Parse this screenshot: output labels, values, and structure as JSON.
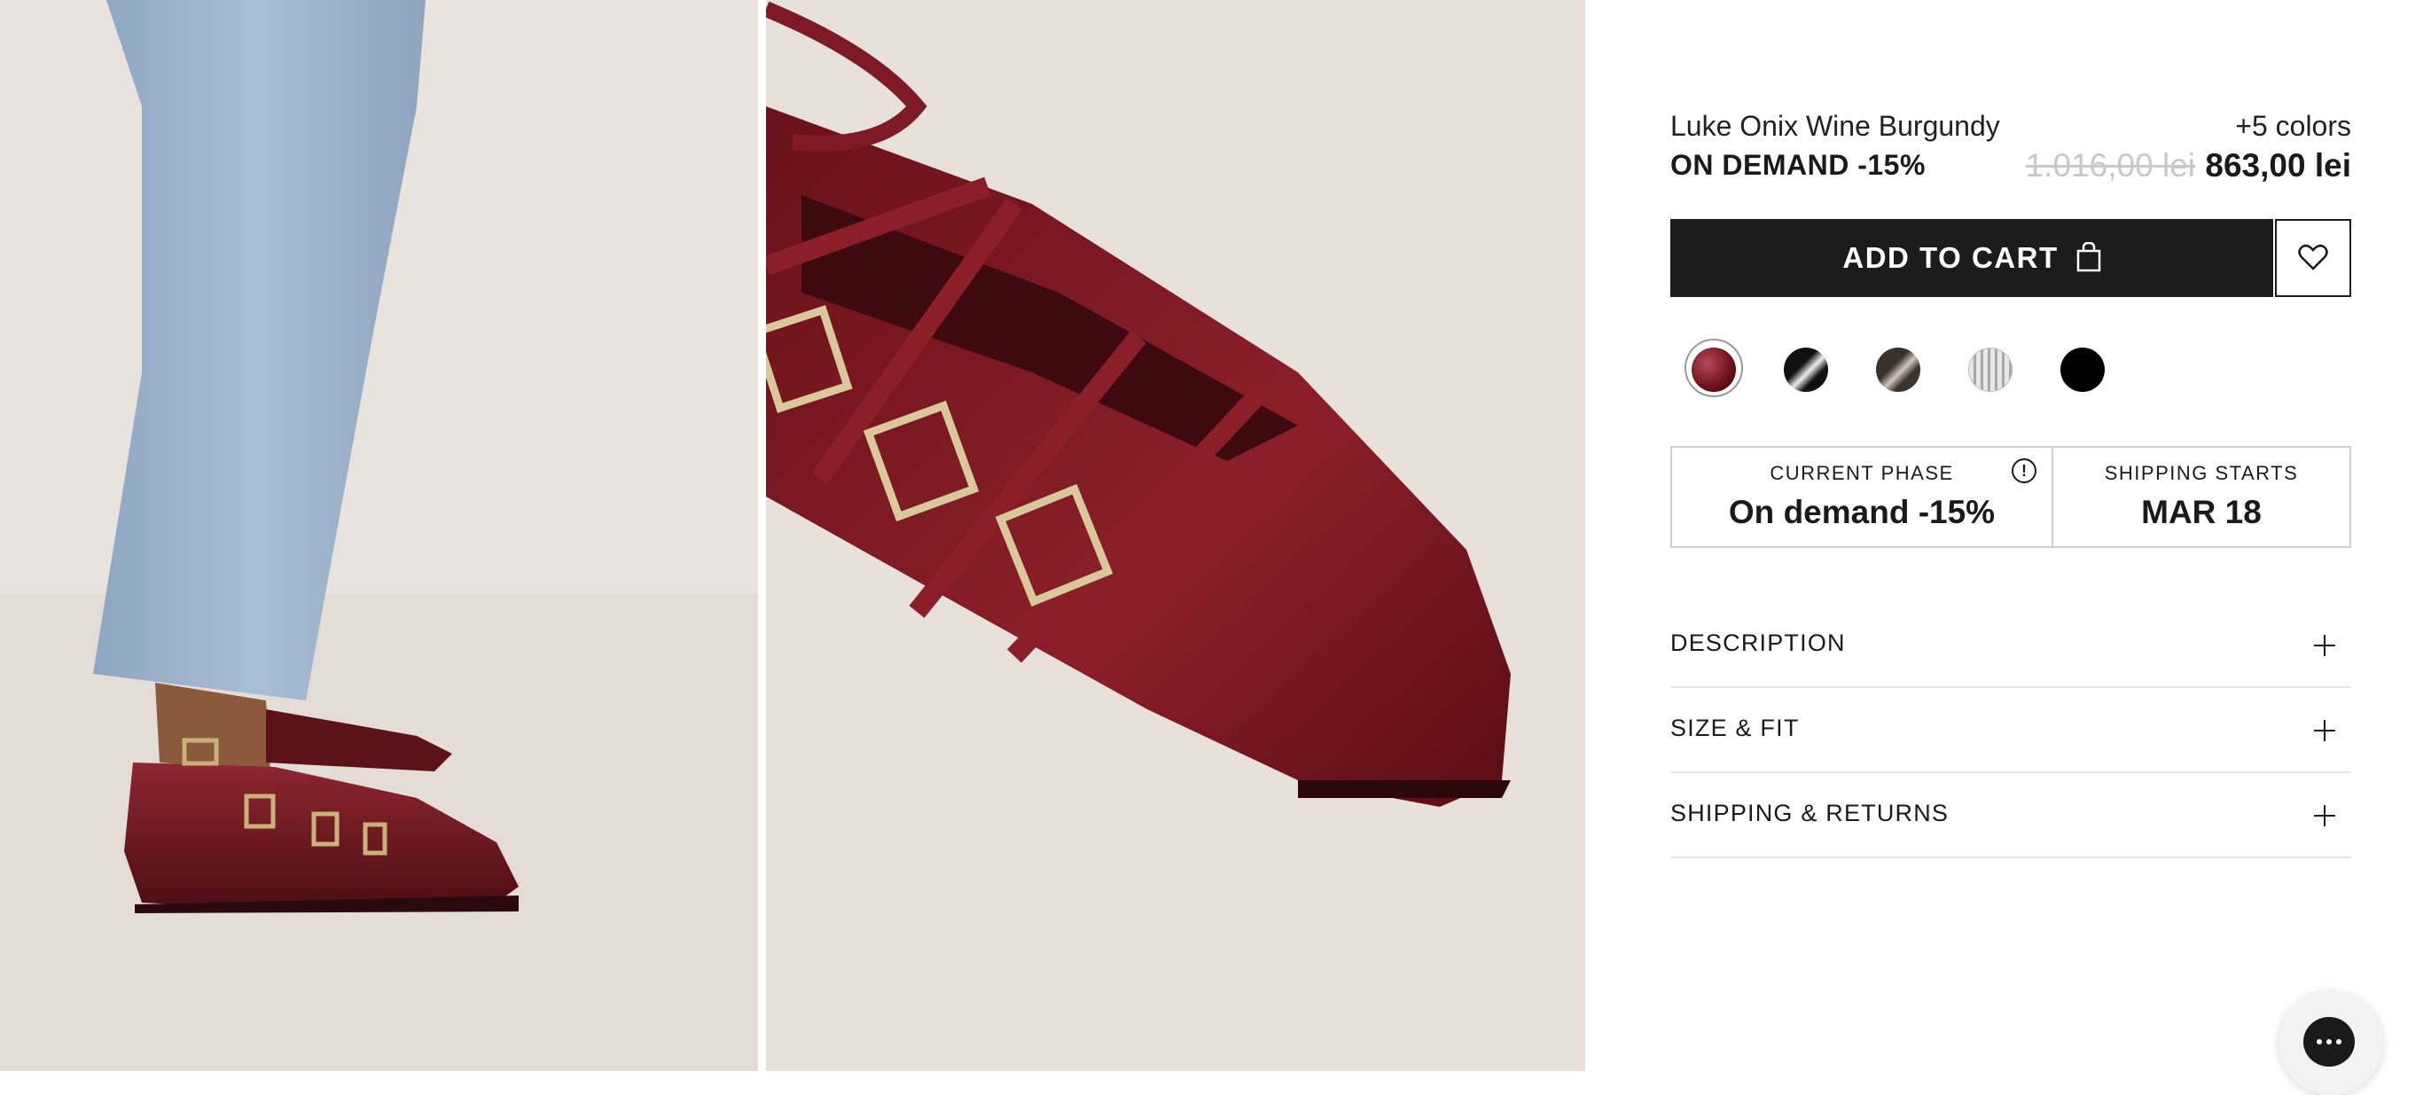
{
  "product": {
    "name": "Luke Onix Wine Burgundy",
    "more_colors": "+5 colors",
    "phase_label": "ON DEMAND -15%",
    "old_price": "1.016,00 lei",
    "new_price": "863,00 lei"
  },
  "actions": {
    "add_to_cart": "ADD TO CART",
    "cart_icon": "shopping-bag-icon",
    "wishlist_icon": "heart-icon"
  },
  "colors": {
    "accent": "#1c1c1c",
    "burgundy": "#7a1a24",
    "muted_price": "#c8c8c8",
    "swatches": [
      "wine-burgundy",
      "black-patent",
      "dark-brown",
      "silver-metallic",
      "black"
    ]
  },
  "info": {
    "current_phase_caption": "CURRENT PHASE",
    "current_phase_value": "On demand -15%",
    "shipping_caption": "SHIPPING STARTS",
    "shipping_value": "MAR 18",
    "info_icon_glyph": "!"
  },
  "accordion": [
    {
      "label": "DESCRIPTION"
    },
    {
      "label": "SIZE & FIT"
    },
    {
      "label": "SHIPPING & RETURNS"
    }
  ],
  "chat": {
    "icon": "chat-icon"
  }
}
